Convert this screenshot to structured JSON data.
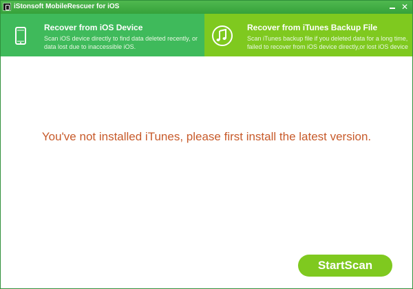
{
  "window": {
    "title": "iStonsoft MobileRescuer for iOS",
    "icons": [
      "app-icon",
      "minimize-icon",
      "close-icon"
    ]
  },
  "tabs": [
    {
      "title": "Recover from iOS Device",
      "desc_line1": "Scan iOS device directly to find data deleted recently, or",
      "desc_line2": "data lost due to inaccessible iOS.",
      "icon": "phone-icon",
      "color": "#3fba5b"
    },
    {
      "title": "Recover from iTunes Backup File",
      "desc_line1": "Scan iTunes backup file if you deleted data for a long time,",
      "desc_line2": "failed to recover from iOS device directly,or lost iOS device",
      "icon": "music-note-icon",
      "color": "#7fc91f"
    }
  ],
  "main": {
    "message": "You've not installed iTunes, please first install the latest version.",
    "message_color": "#c75a2a"
  },
  "footer": {
    "start_button_label": "StartScan"
  }
}
